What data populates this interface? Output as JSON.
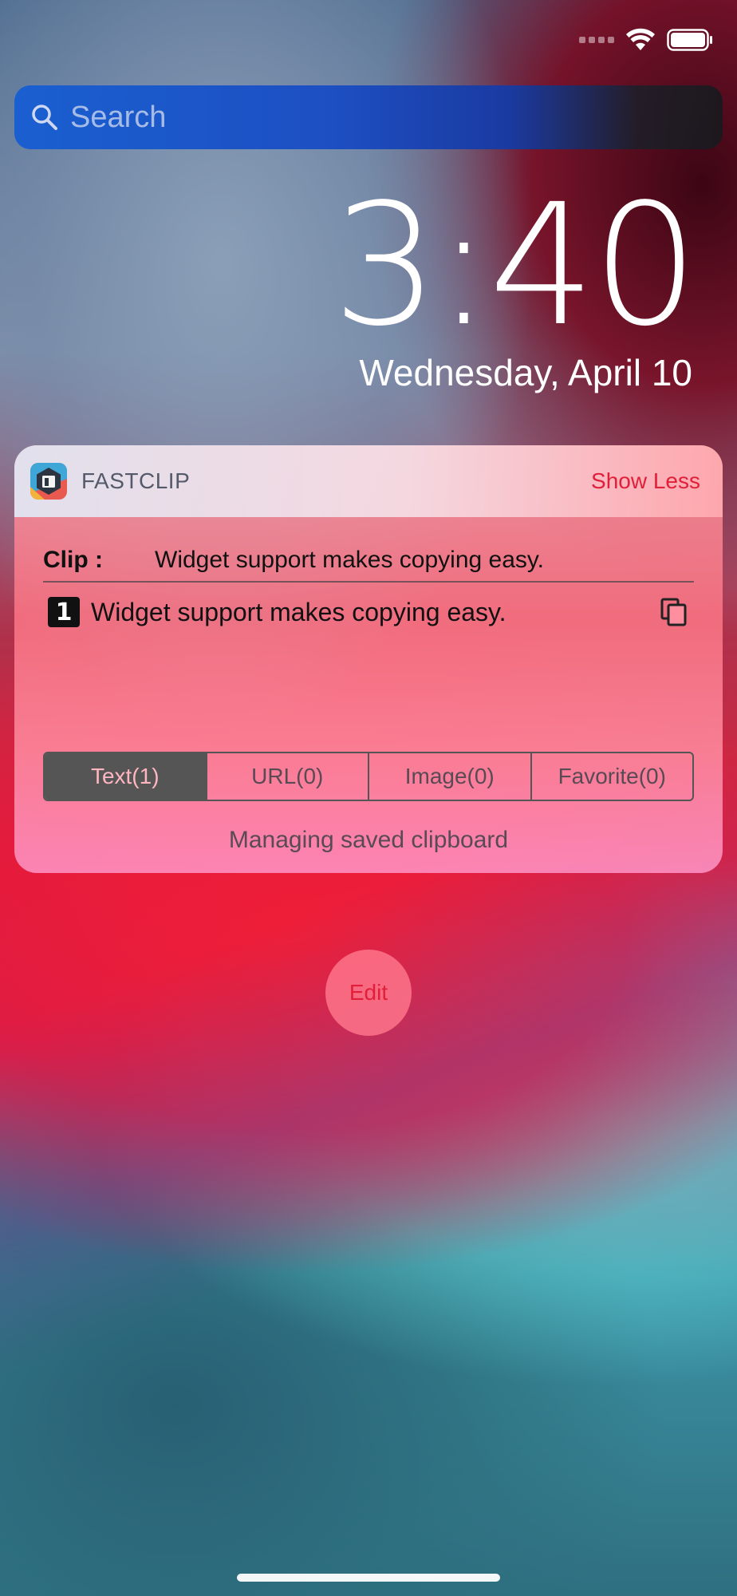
{
  "status_bar": {
    "signal_icon": "cellular-dots-icon",
    "wifi_icon": "wifi-icon",
    "battery_icon": "battery-icon"
  },
  "search": {
    "placeholder": "Search",
    "icon": "search-icon"
  },
  "lock_screen": {
    "time": "3:40",
    "date": "Wednesday, April 10"
  },
  "widget": {
    "app_name": "FASTCLIP",
    "toggle_label": "Show Less",
    "clip_label": "Clip :",
    "clip_value": "Widget support makes copying easy.",
    "items": [
      {
        "index": "1",
        "text": "Widget support makes copying easy.",
        "action_icon": "copy-icon"
      }
    ],
    "tabs": [
      {
        "label": "Text(1)",
        "selected": true
      },
      {
        "label": "URL(0)",
        "selected": false
      },
      {
        "label": "Image(0)",
        "selected": false
      },
      {
        "label": "Favorite(0)",
        "selected": false
      }
    ],
    "footer": "Managing saved clipboard"
  },
  "edit_button": {
    "label": "Edit"
  },
  "colors": {
    "accent_red": "#e0203a",
    "search_blue": "#1d4fc2",
    "segment_dark": "#555555"
  }
}
